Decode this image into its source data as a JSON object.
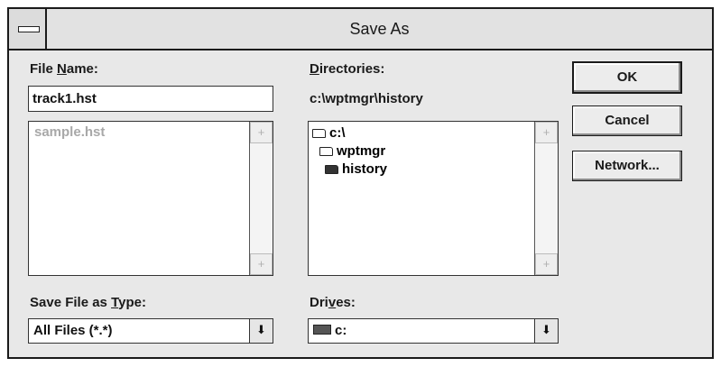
{
  "window": {
    "title": "Save As",
    "system_menu_icon": "system-menu-icon"
  },
  "file_name": {
    "label_pre": "File ",
    "label_ul": "N",
    "label_post": "ame:",
    "value": "track1.hst",
    "files": [
      "sample.hst"
    ]
  },
  "directories": {
    "label_ul": "D",
    "label_post": "irectories:",
    "current_path": "c:\\wptmgr\\history",
    "tree": [
      {
        "label": "c:\\",
        "icon": "open-folder-icon"
      },
      {
        "label": "wptmgr",
        "icon": "open-folder-icon"
      },
      {
        "label": "history",
        "icon": "folder-icon"
      }
    ]
  },
  "save_type": {
    "label_pre": "Save File as ",
    "label_ul": "T",
    "label_post": "ype:",
    "selected": "All Files (*.*)"
  },
  "drives": {
    "label_pre": "Dri",
    "label_ul": "v",
    "label_post": "es:",
    "selected": "c:",
    "icon": "drive-icon"
  },
  "buttons": {
    "ok": "OK",
    "cancel": "Cancel",
    "network": "Network..."
  },
  "scroll_icons": {
    "up": "scroll-up-arrow-icon",
    "down": "scroll-down-arrow-icon",
    "dropdown": "dropdown-arrow-icon"
  }
}
